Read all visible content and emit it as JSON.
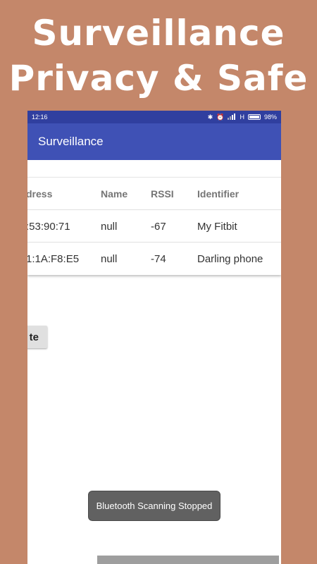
{
  "promo": {
    "line1": "Surveillance",
    "line2": "Privacy & Safe"
  },
  "status_bar": {
    "time": "12:16",
    "bluetooth_icon": "✱",
    "alarm_icon": "⏰",
    "signal_text": "H",
    "battery_percent": "98%",
    "battery_level": 0.98
  },
  "app_bar": {
    "title": "Surveillance"
  },
  "table": {
    "headers": {
      "address": "dress",
      "name": "Name",
      "rssi": "RSSI",
      "identifier": "Identifier"
    },
    "rows": [
      {
        "address": ":53:90:71",
        "name": "null",
        "rssi": "-67",
        "identifier": "My Fitbit"
      },
      {
        "address": "1:1A:F8:E5",
        "name": "null",
        "rssi": "-74",
        "identifier": "Darling phone"
      }
    ]
  },
  "button": {
    "label": "te"
  },
  "toast": {
    "message": "Bluetooth Scanning Stopped"
  }
}
